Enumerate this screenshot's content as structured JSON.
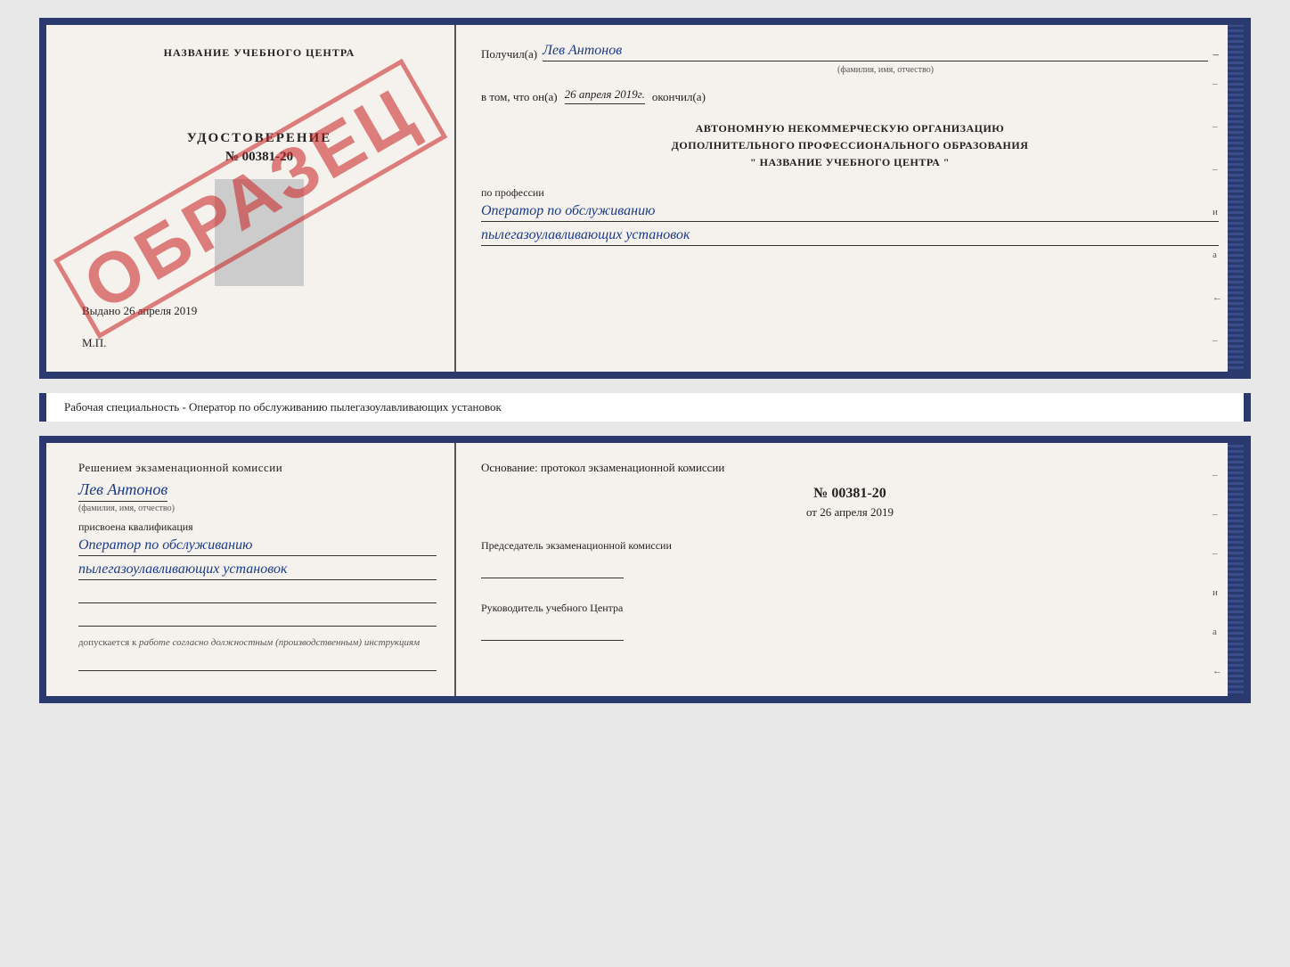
{
  "top_card": {
    "left": {
      "center_title": "НАЗВАНИЕ УЧЕБНОГО ЦЕНТРА",
      "cert_label": "УДОСТОВЕРЕНИЕ",
      "cert_number": "№ 00381-20",
      "issued_label": "Выдано",
      "issued_date": "26 апреля 2019",
      "mp_label": "М.П.",
      "watermark": "ОБРАЗЕЦ"
    },
    "right": {
      "recipient_label": "Получил(а)",
      "recipient_name": "Лев Антонов",
      "fio_label": "(фамилия, имя, отчество)",
      "completed_prefix": "в том, что он(а)",
      "completed_date": "26 апреля 2019г.",
      "completed_suffix": "окончил(а)",
      "org_line1": "АВТОНОМНУЮ НЕКОММЕРЧЕСКУЮ ОРГАНИЗАЦИЮ",
      "org_line2": "ДОПОЛНИТЕЛЬНОГО ПРОФЕССИОНАЛЬНОГО ОБРАЗОВАНИЯ",
      "org_name": "\" НАЗВАНИЕ УЧЕБНОГО ЦЕНТРА \"",
      "profession_label": "по профессии",
      "profession_line1": "Оператор по обслуживанию",
      "profession_line2": "пылегазоулавливающих установок",
      "dashes": [
        "-",
        "-",
        "-",
        "и",
        "а",
        "←",
        "-",
        "-",
        "-",
        "-"
      ]
    }
  },
  "middle_label": "Рабочая специальность - Оператор по обслуживанию пылегазоулавливающих установок",
  "bottom_card": {
    "left": {
      "decision_text": "Решением экзаменационной комиссии",
      "person_name": "Лев Антонов",
      "fio_label": "(фамилия, имя, отчество)",
      "qualification_label": "присвоена квалификация",
      "qualification_line1": "Оператор по обслуживанию",
      "qualification_line2": "пылегазоулавливающих установок",
      "допускается_prefix": "допускается к",
      "допускается_text": "работе согласно должностным (производственным) инструкциям"
    },
    "right": {
      "basis_text": "Основание: протокол экзаменационной комиссии",
      "protocol_number": "№ 00381-20",
      "protocol_date_prefix": "от",
      "protocol_date": "26 апреля 2019",
      "chairman_label": "Председатель экзаменационной комиссии",
      "director_label": "Руководитель учебного Центра",
      "dashes": [
        "-",
        "-",
        "-",
        "и",
        "а",
        "←",
        "-",
        "-"
      ]
    }
  }
}
